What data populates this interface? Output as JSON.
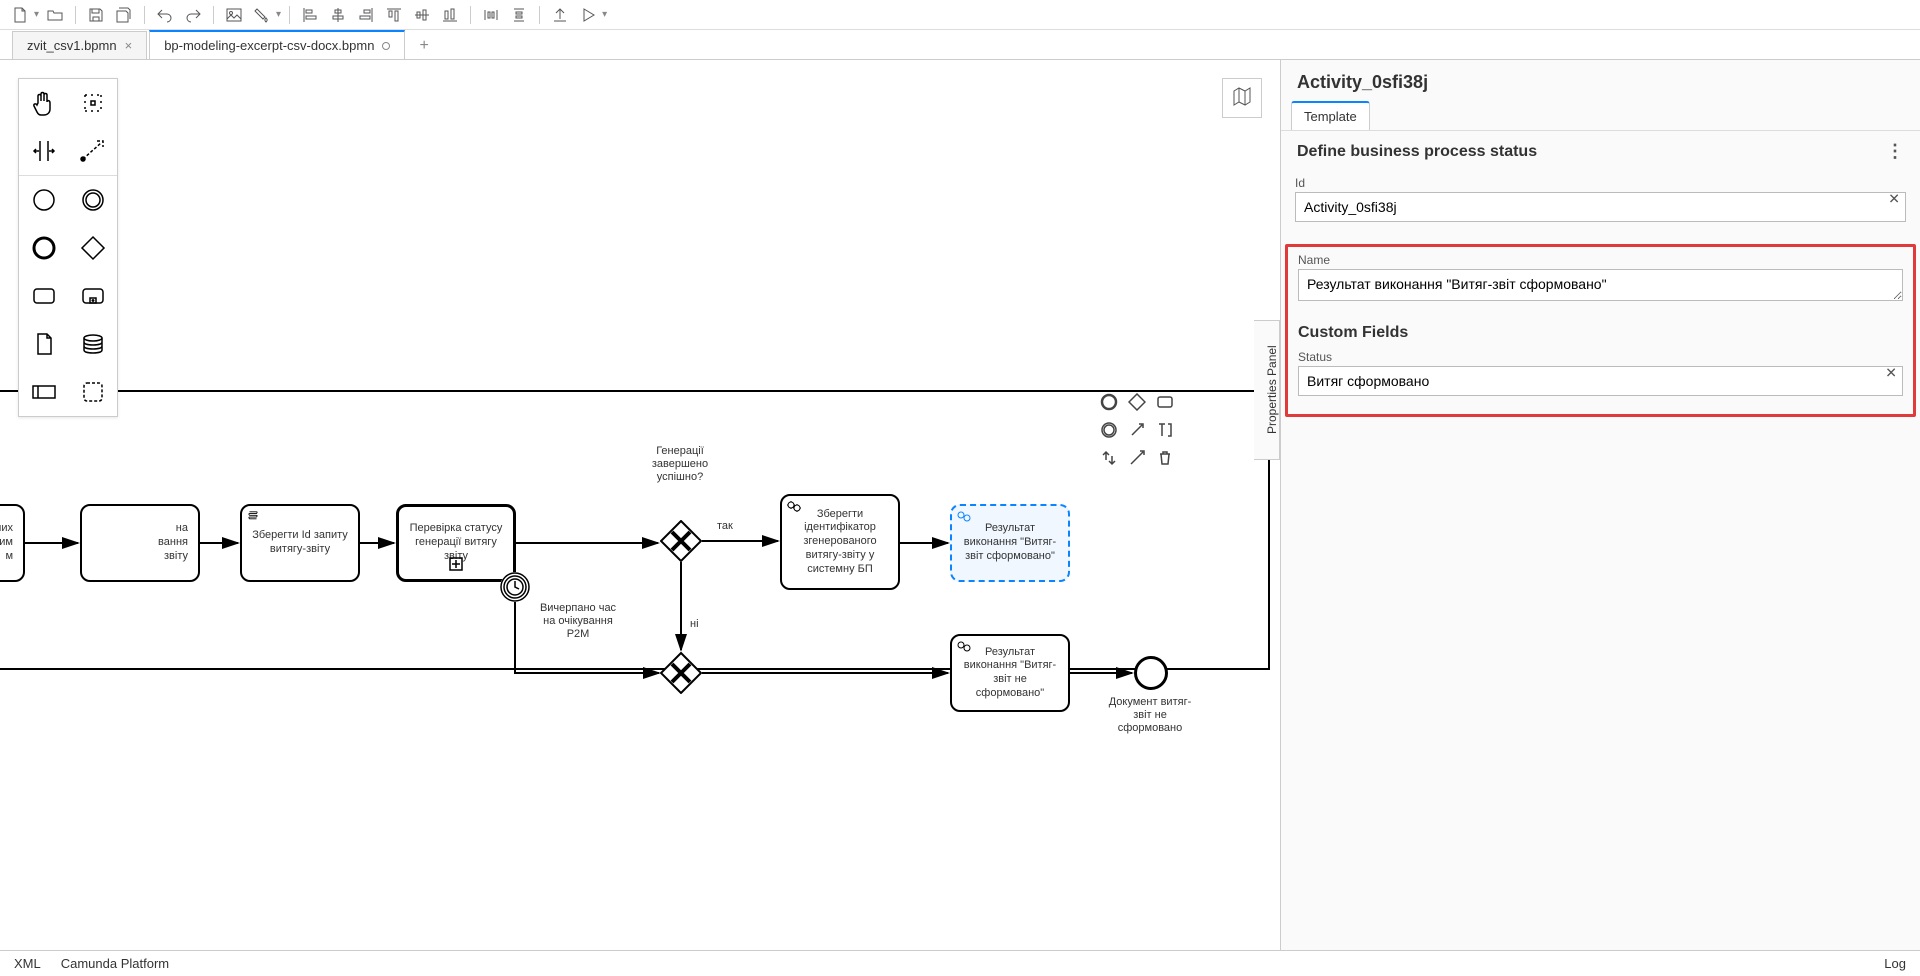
{
  "tabs": [
    {
      "label": "zvit_csv1.bpmn",
      "active": false,
      "dirty": false
    },
    {
      "label": "bp-modeling-excerpt-csv-docx.bpmn",
      "active": true,
      "dirty": true
    }
  ],
  "palette_tools": [
    "hand-tool",
    "lasso-tool",
    "space-tool",
    "global-connect-tool",
    "start-event",
    "intermediate-event",
    "end-event",
    "gateway",
    "task",
    "sub-process",
    "data-object",
    "data-store",
    "participant",
    "group"
  ],
  "diagram": {
    "task_partial_1": "аних\nим\nм",
    "task_partial_2": "на\nвання\nзвіту",
    "task_save_id": "Зберегти Id запиту витягу-звіту",
    "task_check_status": "Перевірка статусу генерації витягу звіту",
    "gateway_label": "Генерації\nзавершено\nуспішно?",
    "edge_yes": "так",
    "edge_no": "ні",
    "task_save_identifier": "Зберегти ідентифікатор згенерованого витягу-звіту у системну БП",
    "task_result_ok": "Результат виконання \"Витяг-звіт сформовано\"",
    "task_result_fail": "Результат виконання \"Витяг-звіт не сформовано\"",
    "timer_label": "Вичерпано час на очікування P2M",
    "end_label": "Документ витяг-звіт не сформовано"
  },
  "panel_tab_label": "Properties Panel",
  "properties": {
    "elementId": "Activity_0sfi38j",
    "tab": "Template",
    "section_title": "Define business process status",
    "id_label": "Id",
    "id_value": "Activity_0sfi38j",
    "name_label": "Name",
    "name_value": "Результат виконання \"Витяг-звіт сформовано\"",
    "custom_fields_title": "Custom Fields",
    "status_label": "Status",
    "status_value": "Витяг сформовано"
  },
  "statusbar": {
    "xml": "XML",
    "platform": "Camunda Platform",
    "log": "Log"
  }
}
